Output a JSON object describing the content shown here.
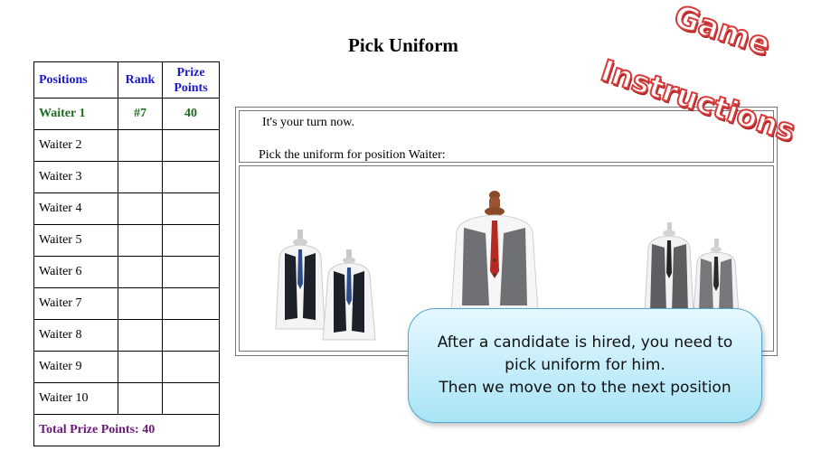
{
  "page": {
    "title": "Pick Uniform"
  },
  "positions_table": {
    "headers": {
      "position": "Positions",
      "rank": "Rank",
      "prize_line1": "Prize",
      "prize_line2": "Points"
    },
    "rows": [
      {
        "position": "Waiter 1",
        "rank": "#7",
        "points": "40"
      },
      {
        "position": "Waiter 2",
        "rank": "",
        "points": ""
      },
      {
        "position": "Waiter 3",
        "rank": "",
        "points": ""
      },
      {
        "position": "Waiter 4",
        "rank": "",
        "points": ""
      },
      {
        "position": "Waiter 5",
        "rank": "",
        "points": ""
      },
      {
        "position": "Waiter 6",
        "rank": "",
        "points": ""
      },
      {
        "position": "Waiter 7",
        "rank": "",
        "points": ""
      },
      {
        "position": "Waiter 8",
        "rank": "",
        "points": ""
      },
      {
        "position": "Waiter 9",
        "rank": "",
        "points": ""
      },
      {
        "position": "Waiter 10",
        "rank": "",
        "points": ""
      }
    ],
    "total": "Total Prize Points: 40"
  },
  "instructions": {
    "turn": "It's your turn now.",
    "pick": "Pick the uniform for position Waiter:"
  },
  "uniforms": [
    {
      "icon": "black-vest-uniform-icon",
      "vest_color": "#1d2129",
      "tie_color": "#2b4b8a"
    },
    {
      "icon": "grey-vest-uniform-icon",
      "vest_color": "#6e7073",
      "tie_color": "#b52a22"
    },
    {
      "icon": "grey-pinstripe-vest-uniform-icon",
      "vest_color": "#5d5e61",
      "tie_color": "#222222"
    }
  ],
  "stamp": {
    "line1": "Game",
    "line2": "Instructions"
  },
  "callout": {
    "line1": "After a candidate is hired, you need to",
    "line2": "pick uniform for him.",
    "line3": "Then we move on to the next position"
  },
  "colors": {
    "header": "#1a1acc",
    "active_row": "#1f6b1f",
    "total": "#6a1a7a",
    "stamp": "#d83a3a"
  }
}
